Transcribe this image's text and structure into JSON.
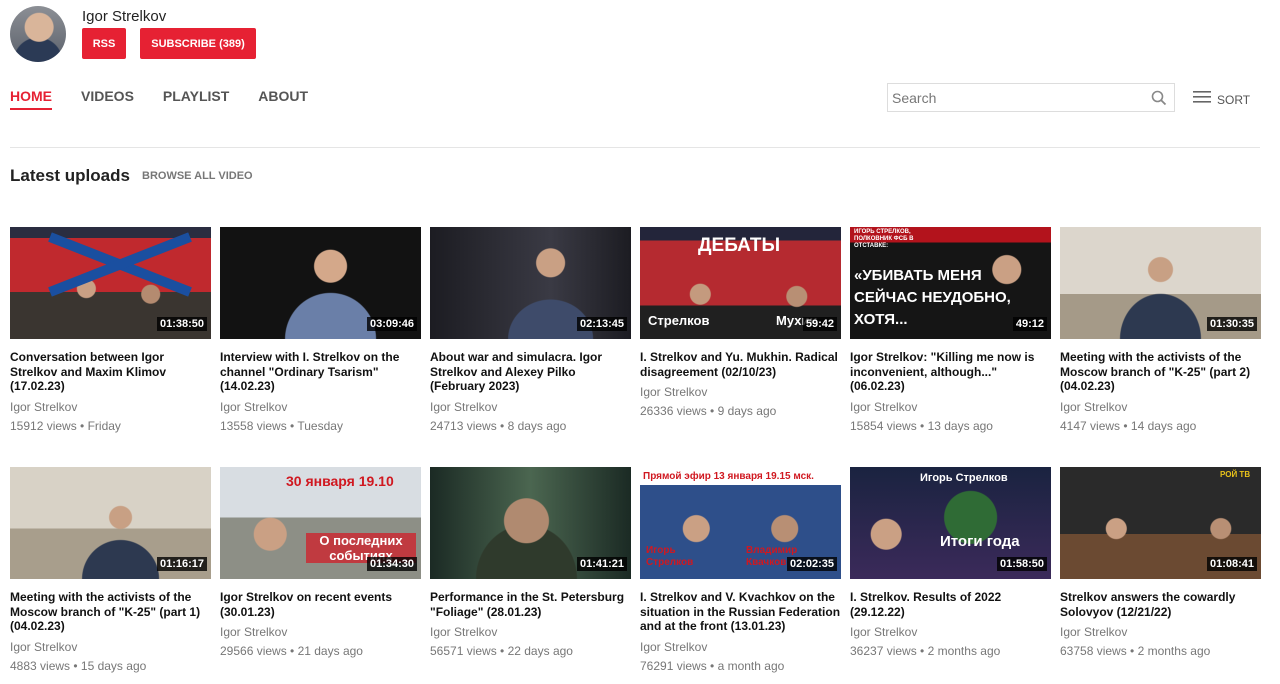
{
  "channel": {
    "name": "Igor Strelkov",
    "rss_label": "RSS",
    "subscribe_label": "SUBSCRIBE (389)"
  },
  "nav": {
    "tabs": [
      "HOME",
      "VIDEOS",
      "PLAYLIST",
      "ABOUT"
    ],
    "active": "HOME"
  },
  "search": {
    "placeholder": "Search"
  },
  "sort_label": "SORT",
  "section": {
    "title": "Latest uploads",
    "browse_label": "BROWSE ALL VIDEO"
  },
  "colors": {
    "accent": "#e62133"
  },
  "videos": [
    {
      "title": "Conversation between Igor Strelkov and Maxim Klimov (17.02.23)",
      "author": "Igor Strelkov",
      "meta": "15912 views • Friday",
      "duration": "01:38:50"
    },
    {
      "title": "Interview with I. Strelkov on the channel \"Ordinary Tsarism\" (14.02.23)",
      "author": "Igor Strelkov",
      "meta": "13558 views • Tuesday",
      "duration": "03:09:46"
    },
    {
      "title": "About war and simulacra. Igor Strelkov and Alexey Pilko (February 2023)",
      "author": "Igor Strelkov",
      "meta": "24713 views • 8 days ago",
      "duration": "02:13:45"
    },
    {
      "title": "I. Strelkov and Yu. Mukhin. Radical disagreement (02/10/23)",
      "author": "Igor Strelkov",
      "meta": "26336 views • 9 days ago",
      "duration": "59:42",
      "overlay": {
        "top": "ДЕБАТЫ",
        "left": "Стрелков",
        "right": "Мухин"
      }
    },
    {
      "title": "Igor Strelkov: \"Killing me now is inconvenient, although...\" (06.02.23)",
      "author": "Igor Strelkov",
      "meta": "15854 views • 13 days ago",
      "duration": "49:12",
      "overlay": {
        "small": "ИГОРЬ СТРЕЛКОВ, ПОЛКОВНИК ФСБ В ОТСТАВКЕ:",
        "big": "«УБИВАТЬ МЕНЯ СЕЙЧАС НЕУДОБНО, ХОТЯ..."
      }
    },
    {
      "title": "Meeting with the activists of the Moscow branch of \"K-25\" (part 2) (04.02.23)",
      "author": "Igor Strelkov",
      "meta": "4147 views • 14 days ago",
      "duration": "01:30:35"
    },
    {
      "title": "Meeting with the activists of the Moscow branch of \"K-25\" (part 1) (04.02.23)",
      "author": "Igor Strelkov",
      "meta": "4883 views • 15 days ago",
      "duration": "01:16:17"
    },
    {
      "title": "Igor Strelkov on recent events (30.01.23)",
      "author": "Igor Strelkov",
      "meta": "29566 views • 21 days ago",
      "duration": "01:34:30",
      "overlay": {
        "top": "30 января 19.10",
        "bottom": "О последних событиях"
      }
    },
    {
      "title": "Performance in the St. Petersburg \"Foliage\" (28.01.23)",
      "author": "Igor Strelkov",
      "meta": "56571 views • 22 days ago",
      "duration": "01:41:21"
    },
    {
      "title": "I. Strelkov and V. Kvachkov on the situation in the Russian Federation and at the front (13.01.23)",
      "author": "Igor Strelkov",
      "meta": "76291 views • a month ago",
      "duration": "02:02:35",
      "overlay": {
        "top": "Прямой эфир 13 января 19.15 мск.",
        "left": "Игорь Стрелков",
        "right": "Владимир Квачков"
      }
    },
    {
      "title": "I. Strelkov. Results of 2022 (29.12.22)",
      "author": "Igor Strelkov",
      "meta": "36237 views • 2 months ago",
      "duration": "01:58:50",
      "overlay": {
        "top": "Игорь Стрелков",
        "bottom": "Итоги года"
      }
    },
    {
      "title": "Strelkov answers the cowardly Solovyov (12/21/22)",
      "author": "Igor Strelkov",
      "meta": "63758 views • 2 months ago",
      "duration": "01:08:41",
      "overlay": {
        "logo": "РОЙ ТВ"
      }
    }
  ]
}
